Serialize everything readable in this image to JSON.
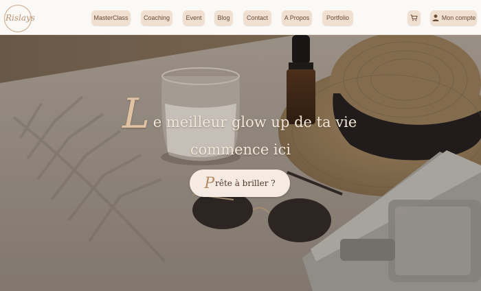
{
  "logo": {
    "text": "Rislays"
  },
  "nav": [
    {
      "label": "MasterClass"
    },
    {
      "label": "Coaching"
    },
    {
      "label": "Event"
    },
    {
      "label": "Blog"
    },
    {
      "label": "Contact"
    },
    {
      "label": "A Propos"
    },
    {
      "label": "Portfolio"
    }
  ],
  "account": {
    "label": "Mon compte"
  },
  "hero": {
    "headline_initial": "L",
    "headline_line1_rest": "e meilleur glow up de ta vie",
    "headline_line2": "commence ici",
    "cta_initial": "P",
    "cta_rest": "rête à briller ?"
  },
  "colors": {
    "accent": "#efe0d2",
    "text": "#6b4a34",
    "headline": "#f2e6d8"
  }
}
